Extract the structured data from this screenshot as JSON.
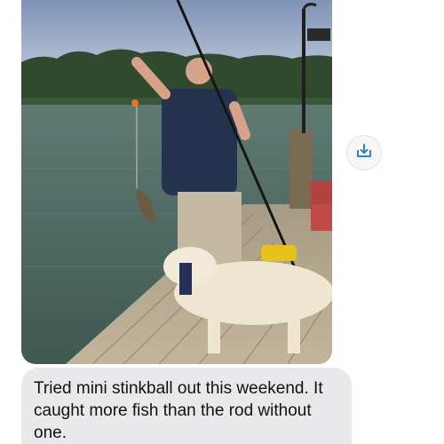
{
  "conversation": {
    "messages": [
      {
        "type": "image",
        "alt_subject": "man-with-fishing-rod-and-dog-on-dock"
      },
      {
        "type": "text",
        "text": "Tried mini stinkball out this weekend. It caught more fish than the rod without one."
      }
    ]
  },
  "actions": {
    "save_icon": "download-tray-icon"
  },
  "colors": {
    "bubble_bg": "#e9e9eb",
    "accent": "#2f7fd7",
    "text": "#111111"
  }
}
